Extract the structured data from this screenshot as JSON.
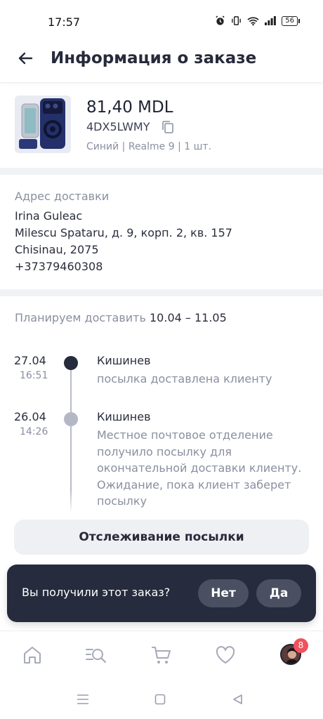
{
  "status_bar": {
    "time": "17:57",
    "battery": "56"
  },
  "header": {
    "title": "Информация о заказе"
  },
  "product": {
    "price": "81,40 MDL",
    "order_code": "4DX5LWMY",
    "variant": "Синий | Realme 9 | 1 шт."
  },
  "address": {
    "label": "Адрес доставки",
    "name": "Irina Guleac",
    "street": "Milescu Spataru, д. 9, корп. 2, кв. 157",
    "city": "Chisinau, 2075",
    "phone": "+37379460308"
  },
  "delivery_plan": {
    "label": "Планируем доставить",
    "dates": "10.04 – 11.05"
  },
  "tracking_events": [
    {
      "date": "27.04",
      "time": "16:51",
      "city": "Кишинев",
      "description": "посылка доставлена клиенту",
      "dot_color": "#262b3d"
    },
    {
      "date": "26.04",
      "time": "14:26",
      "city": "Кишинев",
      "description": "Местное почтовое отделение получило посылку для окончательной доставки клиенту. Ожидание, пока клиент заберет посылку",
      "dot_color": "#b4b7c5"
    }
  ],
  "track_button": {
    "label": "Отслеживание посылки"
  },
  "received_prompt": {
    "question": "Вы получили этот заказ?",
    "no_label": "Нет",
    "yes_label": "Да"
  },
  "bottom_nav": {
    "items": [
      "home-icon",
      "search-catalog-icon",
      "cart-icon",
      "heart-icon",
      "profile-avatar"
    ],
    "badge_count": "8"
  },
  "colors": {
    "accent_dark": "#262b3d",
    "badge_red": "#f0525d",
    "muted_text": "#8a8fa0"
  }
}
